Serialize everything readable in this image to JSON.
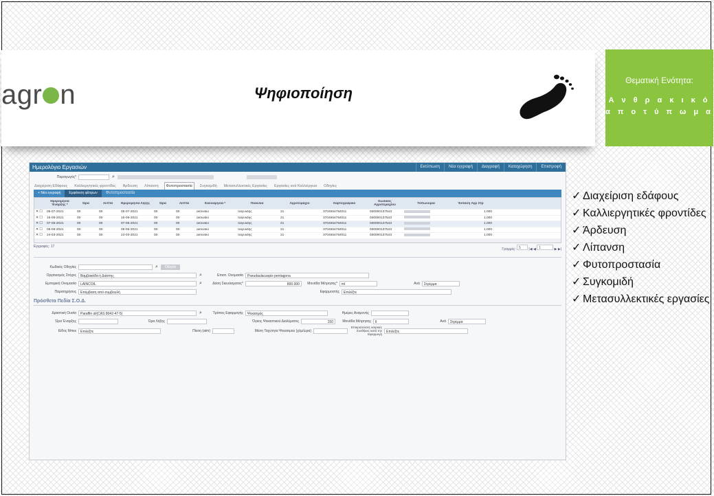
{
  "slide": {
    "brand": {
      "pre": "agr",
      "post": "n"
    },
    "title": "Ψηφιοποίηση",
    "theme_box": {
      "label": "Θεματική Ενότητα:",
      "topic_line1": "Α ν θ ρ α κ ι κ ό",
      "topic_line2": "α π ο τ ύ π ω μ α"
    },
    "checklist": [
      "Διαχείριση εδάφους",
      "Καλλιεργητικές φροντίδες",
      "Άρδευση",
      "Λίπανση",
      "Φυτοπροστασία",
      "Συγκομιδή",
      "Μετασυλλεκτικές εργασίες"
    ],
    "check_mark": "✓",
    "colors": {
      "green": "#8bc53f",
      "titlebar": "#2f6f9c"
    }
  },
  "app": {
    "title": "Ημερολόγιο Εργασιών",
    "toolbar": [
      "Εκτύπωση",
      "Νέα εγγραφή",
      "Διαγραφή",
      "Καταχώρηση",
      "Επιστροφή"
    ],
    "producer_label": "Παραγωγός*",
    "tabs": [
      "Διαχείριση Εδάφους",
      "Καλλιεργητικές φροντίδες",
      "Άρδευση",
      "Λίπανση",
      "Φυτοπροστασία",
      "Συγκομιδή",
      "Μετασυλλεκτικές Εργασίες",
      "Εργασίες ανά Καλλιέργεια",
      "Οδηγίες"
    ],
    "active_tab": 4,
    "subbar": {
      "new": "Νέα εγγραφή",
      "filters": "Εμφάνιση φίλτρων",
      "section": "Φυτοπροστασία"
    },
    "columns": [
      "Ημερομηνία Έναρξης *",
      "Ώρα",
      "Λεπτά",
      "Ημερομηνία Λήξης",
      "Ώρα",
      "Λεπτά",
      "Καλλιέργεια *",
      "Ποικιλία",
      "Αγροτεμάχιο",
      "Χαρτογραφικό",
      "Κωδικός Αγροτεμαχίου",
      "Τοπωνυμία",
      "Έκταση Αγρ Στρ"
    ],
    "rows": [
      {
        "start": "05-07-2021",
        "h1": "00",
        "m1": "00",
        "end": "05-07-2021",
        "h2": "00",
        "m2": "00",
        "crop": "ακτινίδιο",
        "variety": "ταιγυλδης",
        "plot": "21",
        "map": "3704554784011",
        "code": "030000137543",
        "area": "1.000"
      },
      {
        "start": "16-06-2021",
        "h1": "00",
        "m1": "00",
        "end": "16-06-2021",
        "h2": "00",
        "m2": "00",
        "crop": "ακτινίδιο",
        "variety": "ταιγυλδης",
        "plot": "21",
        "map": "3704554784011",
        "code": "030000137543",
        "area": "1.000"
      },
      {
        "start": "07-05-2021",
        "h1": "00",
        "m1": "00",
        "end": "07-05-2021",
        "h2": "00",
        "m2": "00",
        "crop": "ακτινίδιο",
        "variety": "ταιγυλδης",
        "plot": "21",
        "map": "3704554784011",
        "code": "030000137543",
        "area": "1.000"
      },
      {
        "start": "05-05-2021",
        "h1": "00",
        "m1": "00",
        "end": "05-05-2021",
        "h2": "00",
        "m2": "00",
        "crop": "ακτινίδιο",
        "variety": "ταιγυλδης",
        "plot": "21",
        "map": "3704554784011",
        "code": "030000137543",
        "area": "1.000"
      },
      {
        "start": "24-03-2021",
        "h1": "00",
        "m1": "00",
        "end": "24-03-2021",
        "h2": "00",
        "m2": "00",
        "crop": "ακτινίδιο",
        "variety": "ταιγυλδης",
        "plot": "21",
        "map": "3704554784011",
        "code": "030000137543",
        "area": "1.000"
      }
    ],
    "records": "Εγγραφές: 17",
    "pager": {
      "rows_label": "Γραμμές:",
      "rows": "5",
      "page": "1"
    },
    "form": {
      "guide_code_label": "Κωδικός Οδηγίας",
      "guide_btn": "Οδηγία",
      "organism_label": "Οργανισμός Στόχος",
      "organism": "Βαμβακάδα ή Διάστης",
      "sci_label": "Επιστ. Ονομασία",
      "sci": "Pseudaulacaspis pentagona",
      "commercial_label": "Εμπορική Ονομασία",
      "commercial": "LAINCOIL",
      "dose_label": "Δόση Σκευάσματος*",
      "dose": "800.000",
      "unit_label": "Μονάδα Μέτρησης*",
      "unit": "ml",
      "per_label": "Ανά",
      "per": "Στρέμμα",
      "notes_label": "Παρατηρήσεις",
      "notes": "Επέμβαση από συμβουλή",
      "applicator_label": "Εφαρμοστής",
      "applicator": "Επιλέξτε"
    },
    "extra_title": "Πρόσθετα Πεδία Σ.Ο.Δ.",
    "extra": {
      "active_label": "Δραστική Ουσία",
      "active": "Paraffin oil(CAS 8042-47-5)",
      "method_label": "Τρόπος Εφαρμογής",
      "method": "Ψεκασμός",
      "wait_label": "Ημέρες Αναμονής",
      "start_time_label": "Ώρα Έναρξης",
      "end_time_label": "Ώρα Λήξης",
      "volume_label": "Όγκος Ψεκαστικού Διαλύματος",
      "volume": "150",
      "unit2_label": "Μονάδα Μέτρησης",
      "unit2": "lt",
      "per2_label": "Ανά",
      "per2": "Στρέμμα",
      "nozzle_label": "Είδος Μπεκ",
      "nozzle": "Επιλέξτε",
      "pressure_label": "Πίεση (atm)",
      "speed_label": "Μέση Ταχύτητα Ψεκασμού (χλμ/ώρα)",
      "weather_label": "Επικρατούσες καιρικές Συνθήκες κατά την Εφαρμογή",
      "weather": "Επιλέξτε"
    }
  }
}
